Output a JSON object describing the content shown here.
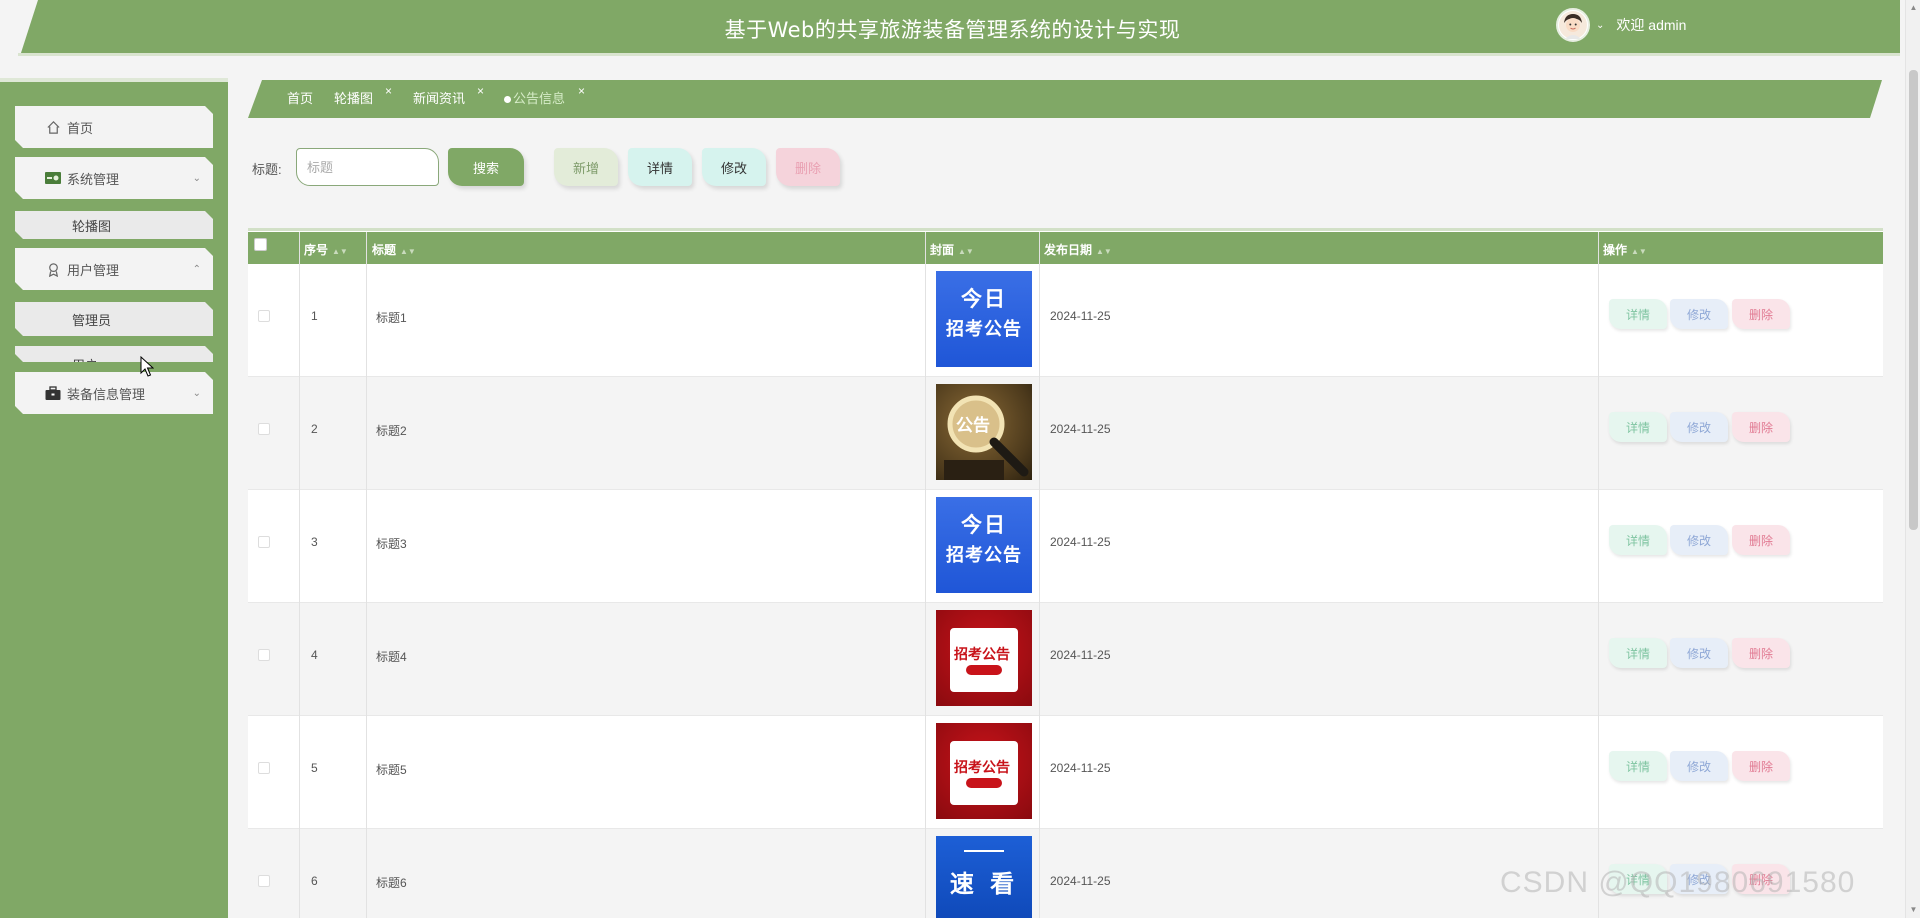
{
  "header": {
    "title": "基于Web的共享旅游装备管理系统的设计与实现",
    "welcome": "欢迎 admin"
  },
  "sidebar": {
    "home": "首页",
    "system_mgmt": "系统管理",
    "carousel": "轮播图",
    "user_mgmt": "用户管理",
    "admin": "管理员",
    "user": "用户",
    "equipment_mgmt": "装备信息管理"
  },
  "tabs": [
    {
      "label": "首页"
    },
    {
      "label": "轮播图"
    },
    {
      "label": "新闻资讯"
    },
    {
      "label": "公告信息"
    }
  ],
  "search": {
    "label": "标题:",
    "placeholder": "标题",
    "search_button": "搜索"
  },
  "toolbar": {
    "add": "新增",
    "detail": "详情",
    "edit": "修改",
    "delete": "删除"
  },
  "table": {
    "columns": {
      "index": "序号",
      "title": "标题",
      "cover": "封面",
      "date": "发布日期",
      "actions": "操作"
    },
    "row_actions": {
      "detail": "详情",
      "edit": "修改",
      "delete": "删除"
    },
    "rows": [
      {
        "index": "1",
        "title": "标题1",
        "date": "2024-11-25",
        "cover": "blue",
        "cover_l1": "今日",
        "cover_l2": "招考公告"
      },
      {
        "index": "2",
        "title": "标题2",
        "date": "2024-11-25",
        "cover": "gold",
        "cover_l1": "公告"
      },
      {
        "index": "3",
        "title": "标题3",
        "date": "2024-11-25",
        "cover": "blue",
        "cover_l1": "今日",
        "cover_l2": "招考公告"
      },
      {
        "index": "4",
        "title": "标题4",
        "date": "2024-11-25",
        "cover": "red",
        "cover_l1": "招考公告"
      },
      {
        "index": "5",
        "title": "标题5",
        "date": "2024-11-25",
        "cover": "red",
        "cover_l1": "招考公告"
      },
      {
        "index": "6",
        "title": "标题6",
        "date": "2024-11-25",
        "cover": "news",
        "cover_l1": "速 看"
      }
    ]
  },
  "watermark": "CSDN @QQ1980691580",
  "colors": {
    "primary": "#80a866",
    "row_alt": "#f4f4f4"
  }
}
